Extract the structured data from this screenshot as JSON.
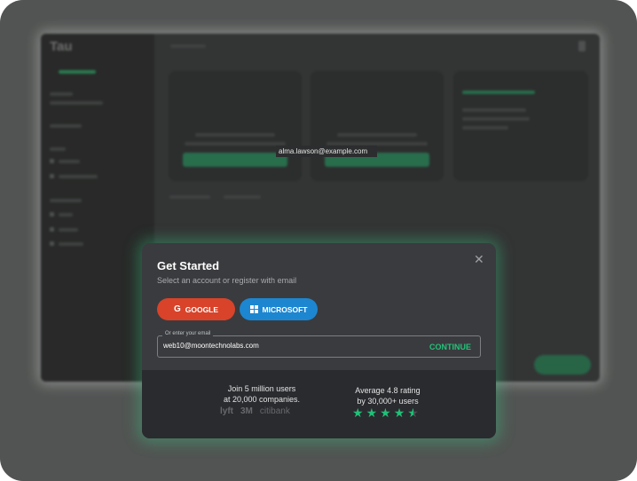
{
  "app": {
    "logo_text": "Tau"
  },
  "tooltip": {
    "email": "alma.lawson@example.com"
  },
  "modal": {
    "title": "Get Started",
    "subtitle": "Select an account or register with email",
    "google_label": "GOOGLE",
    "microsoft_label": "MICROSOFT",
    "email_legend": "Or enter your email",
    "email_value": "web10@moontechnolabs.com",
    "continue_label": "CONTINUE",
    "footer_left_line1": "Join 5 million users",
    "footer_left_line2": "at 20,000 companies.",
    "logos": {
      "lyft": "lyft",
      "threem": "3M",
      "citi": "citibank"
    },
    "footer_right_line1": "Average 4.8 rating",
    "footer_right_line2": "by 30,000+ users",
    "rating": 4.5
  },
  "colors": {
    "accent": "#20c078",
    "google": "#d8432a",
    "microsoft": "#1d86d0"
  }
}
